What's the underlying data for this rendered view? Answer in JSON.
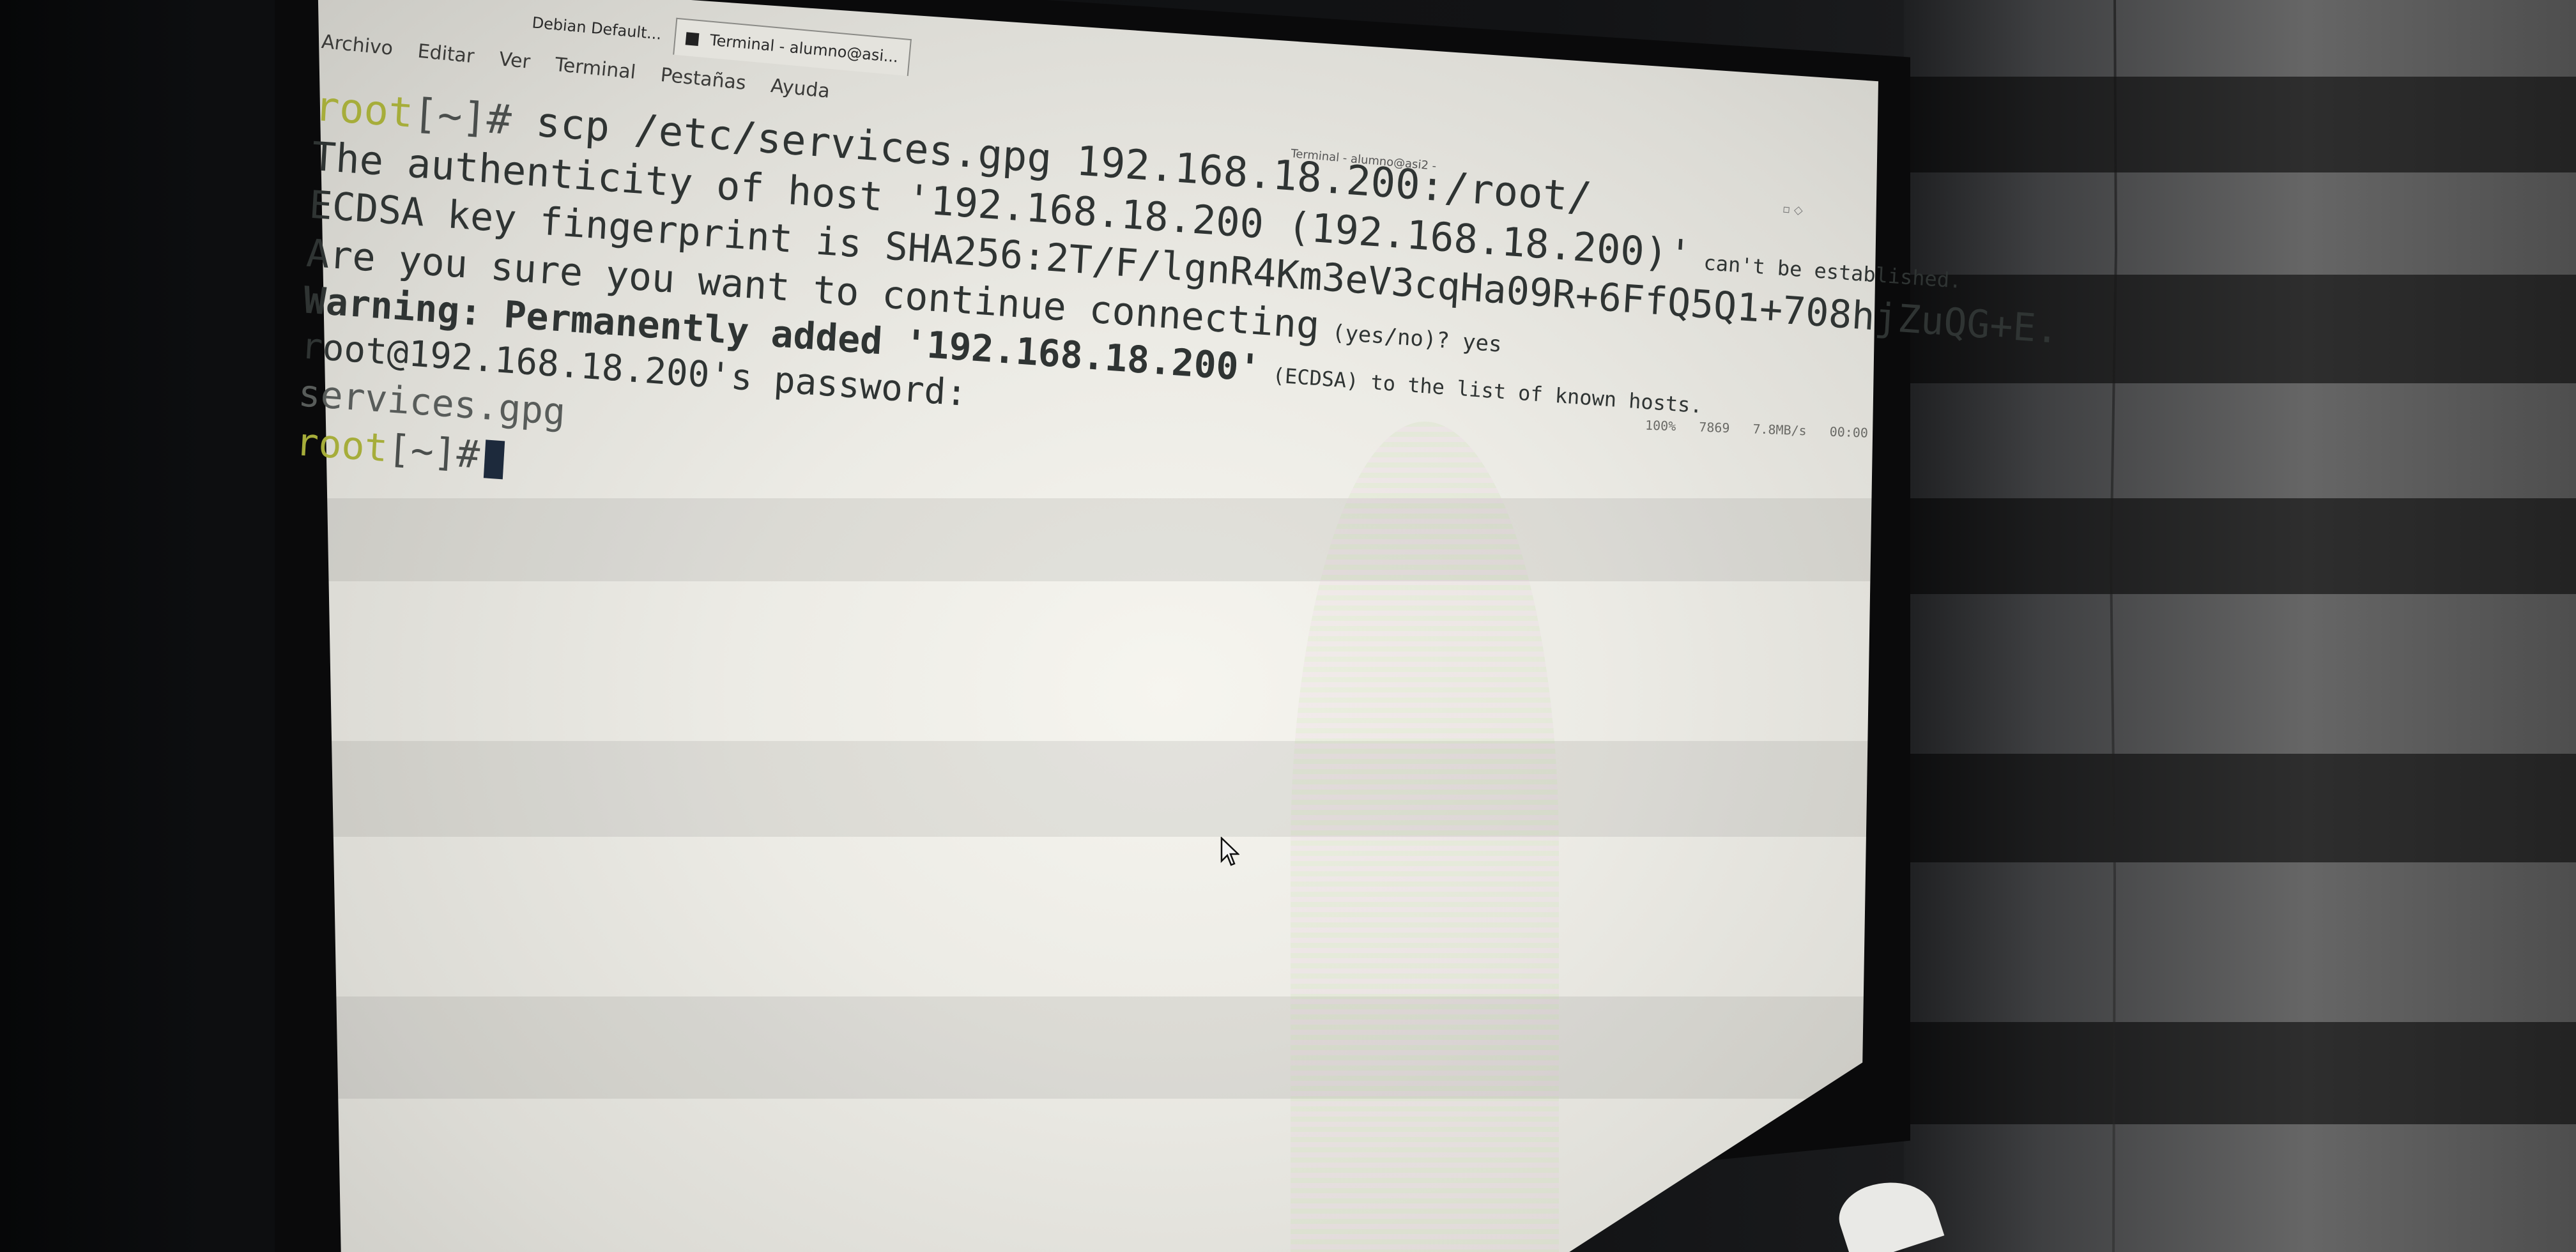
{
  "window": {
    "tabs": [
      {
        "label": "Debian Default..."
      },
      {
        "label": "Terminal - alumno@asi..."
      }
    ],
    "title": "Terminal - alumno@asi2 -"
  },
  "menubar": {
    "items": [
      "Archivo",
      "Editar",
      "Ver",
      "Terminal",
      "Pestañas",
      "Ayuda"
    ]
  },
  "terminal": {
    "prompt_user": "root",
    "prompt_rest": "[~]#",
    "command": "scp /etc/services.gpg 192.168.18.200:/root/",
    "output": [
      {
        "large": "The authenticity of host '192.168.18.200 (192.168.18.200)'",
        "small": " can't be established."
      },
      {
        "large": "ECDSA key fingerprint is SHA256:2T/F/lgnR4Km3eV3cqHa09R+6FfQ5Q1+708hjZuQG+E.",
        "small": ""
      },
      {
        "large": "Are you sure you want to continue connecting",
        "small": " (yes/no)? yes"
      },
      {
        "large": "Warning: Permanently added '192.168.18.200'",
        "small": " (ECDSA) to the list of known hosts."
      },
      {
        "large": "root@192.168.18.200's password:",
        "small": ""
      },
      {
        "large": "services.gpg",
        "small": ""
      }
    ],
    "transfer": {
      "percent": "100%",
      "size": "7869",
      "rate": "7.8MB/s",
      "time": "00:00"
    }
  },
  "colors": {
    "prompt_user": "#a6ad3a",
    "terminal_text": "#2f3433",
    "cursor": "#1d2a3c",
    "screen_bg": "#efeee8"
  },
  "icons": {
    "terminal_tab": "terminal-icon",
    "pointer": "mouse-pointer-icon"
  }
}
